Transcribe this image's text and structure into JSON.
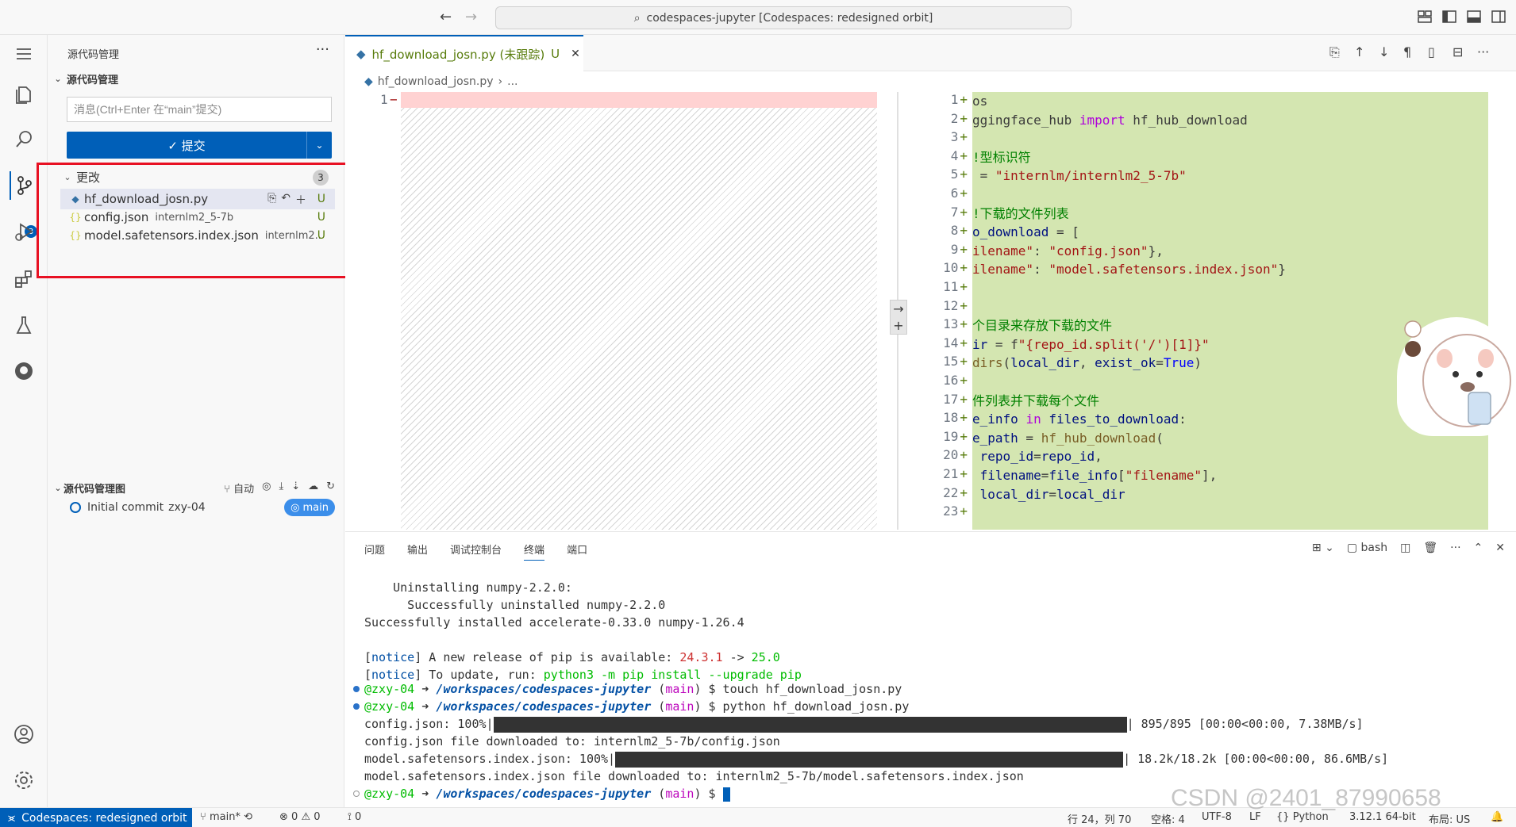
{
  "titlebar": {
    "search": "codespaces-jupyter [Codespaces: redesigned orbit]"
  },
  "activity": {
    "scm_badge": "3"
  },
  "sidebar": {
    "title": "源代码管理",
    "more": "···",
    "section": "源代码管理",
    "commit_placeholder": "消息(Ctrl+Enter 在“main”提交)",
    "commit_label": "✓ 提交",
    "changes_label": "更改",
    "changes_count": "3",
    "files": [
      {
        "name": "hf_download_josn.py",
        "desc": "",
        "status": "U"
      },
      {
        "name": "config.json",
        "desc": "internlm2_5-7b",
        "status": "U"
      },
      {
        "name": "model.safetensors.index.json",
        "desc": "internlm2...",
        "status": "U"
      }
    ],
    "graph_title": "源代码管理图",
    "graph_auto": "自动",
    "commit_msg": "Initial commit",
    "commit_author": "zxy-04",
    "branch": "main"
  },
  "editor": {
    "tab_label": "hf_download_josn.py (未跟踪)",
    "tab_status": "U",
    "breadcrumb_file": "hf_download_josn.py",
    "breadcrumb_more": "...",
    "left_line": "1",
    "right_lines": [
      {
        "n": "1",
        "segs": [
          [
            "t",
            "os"
          ]
        ]
      },
      {
        "n": "2",
        "segs": [
          [
            "t",
            "ggingface_hub "
          ],
          [
            "kw",
            "import"
          ],
          [
            "t",
            " hf_hub_download"
          ]
        ]
      },
      {
        "n": "3",
        "segs": []
      },
      {
        "n": "4",
        "segs": [
          [
            "cm",
            "!型标识符"
          ]
        ]
      },
      {
        "n": "5",
        "segs": [
          [
            "t",
            " = "
          ],
          [
            "str",
            "\"internlm/internlm2_5-7b\""
          ]
        ]
      },
      {
        "n": "6",
        "segs": []
      },
      {
        "n": "7",
        "segs": [
          [
            "cm",
            "!下载的文件列表"
          ]
        ]
      },
      {
        "n": "8",
        "segs": [
          [
            "vr",
            "o_download"
          ],
          [
            "t",
            " = ["
          ]
        ]
      },
      {
        "n": "9",
        "segs": [
          [
            "str",
            "ilename\""
          ],
          [
            "t",
            ": "
          ],
          [
            "str",
            "\"config.json\""
          ],
          [
            "t",
            "},"
          ]
        ]
      },
      {
        "n": "10",
        "segs": [
          [
            "str",
            "ilename\""
          ],
          [
            "t",
            ": "
          ],
          [
            "str",
            "\"model.safetensors.index.json\""
          ],
          [
            "t",
            "}"
          ]
        ]
      },
      {
        "n": "11",
        "segs": []
      },
      {
        "n": "12",
        "segs": []
      },
      {
        "n": "13",
        "segs": [
          [
            "cm",
            "个目录来存放下载的文件"
          ]
        ]
      },
      {
        "n": "14",
        "segs": [
          [
            "vr",
            "ir"
          ],
          [
            "t",
            " = f"
          ],
          [
            "str",
            "\"{repo_id.split('/')[1]}\""
          ]
        ]
      },
      {
        "n": "15",
        "segs": [
          [
            "fn",
            "dirs"
          ],
          [
            "t",
            "("
          ],
          [
            "vr",
            "local_dir"
          ],
          [
            "t",
            ", "
          ],
          [
            "vr",
            "exist_ok"
          ],
          [
            "t",
            "="
          ],
          [
            "bool",
            "True"
          ],
          [
            "t",
            ")"
          ]
        ]
      },
      {
        "n": "16",
        "segs": []
      },
      {
        "n": "17",
        "segs": [
          [
            "cm",
            "件列表并下载每个文件"
          ]
        ]
      },
      {
        "n": "18",
        "segs": [
          [
            "vr",
            "e_info"
          ],
          [
            "t",
            " "
          ],
          [
            "kw",
            "in"
          ],
          [
            "t",
            " "
          ],
          [
            "vr",
            "files_to_download"
          ],
          [
            "t",
            ":"
          ]
        ]
      },
      {
        "n": "19",
        "segs": [
          [
            "vr",
            "e_path"
          ],
          [
            "t",
            " = "
          ],
          [
            "fn",
            "hf_hub_download"
          ],
          [
            "t",
            "("
          ]
        ]
      },
      {
        "n": "20",
        "segs": [
          [
            "t",
            " "
          ],
          [
            "vr",
            "repo_id"
          ],
          [
            "t",
            "="
          ],
          [
            "vr",
            "repo_id"
          ],
          [
            "t",
            ","
          ]
        ]
      },
      {
        "n": "21",
        "segs": [
          [
            "t",
            " "
          ],
          [
            "vr",
            "filename"
          ],
          [
            "t",
            "="
          ],
          [
            "vr",
            "file_info"
          ],
          [
            "t",
            "["
          ],
          [
            "str",
            "\"filename\""
          ],
          [
            "t",
            "],"
          ]
        ]
      },
      {
        "n": "22",
        "segs": [
          [
            "t",
            " "
          ],
          [
            "vr",
            "local_dir"
          ],
          [
            "t",
            "="
          ],
          [
            "vr",
            "local_dir"
          ]
        ]
      },
      {
        "n": "23",
        "segs": []
      }
    ]
  },
  "panel": {
    "tabs": [
      "问题",
      "输出",
      "调试控制台",
      "终端",
      "端口"
    ],
    "active_tab": "终端",
    "shell": "bash",
    "term": {
      "l1": "    Uninstalling numpy-2.2.0:",
      "l2": "      Successfully uninstalled numpy-2.2.0",
      "l3": "Successfully installed accelerate-0.33.0 numpy-1.26.4",
      "notice": "notice",
      "l5a": " A new release of pip is available: ",
      "l5b": "24.3.1",
      "l5c": " -> ",
      "l5d": "25.0",
      "l6a": " To update, run: ",
      "l6b": "python3 -m pip install --upgrade pip",
      "user": "@zxy-04",
      "arrow": " ➜ ",
      "path": "/workspaces/codespaces-jupyter",
      "branch": "main",
      "cmd1": "$ touch hf_download_josn.py",
      "cmd2": "$ python hf_download_josn.py",
      "cmd3": "$ ",
      "p1a": "config.json: 100%",
      "p1b": "895/895 [00:00<00:00, 7.38MB/s]",
      "p1c": "config.json file downloaded to: internlm2_5-7b/config.json",
      "p2a": "model.safetensors.index.json: 100%",
      "p2b": "18.2k/18.2k [00:00<00:00, 86.6MB/s]",
      "p2c": "model.safetensors.index.json file downloaded to: internlm2_5-7b/model.safetensors.index.json"
    }
  },
  "statusbar": {
    "remote": "Codespaces: redesigned orbit",
    "branch": "main*",
    "errors": "0",
    "warnings": "0",
    "ports": "0",
    "position": "行 24，列 70",
    "spaces": "空格: 4",
    "encoding": "UTF-8",
    "eol": "LF",
    "language": "Python",
    "interpreter": "3.12.1 64-bit",
    "layout": "布局: US"
  },
  "watermark": "CSDN @2401_87990658"
}
